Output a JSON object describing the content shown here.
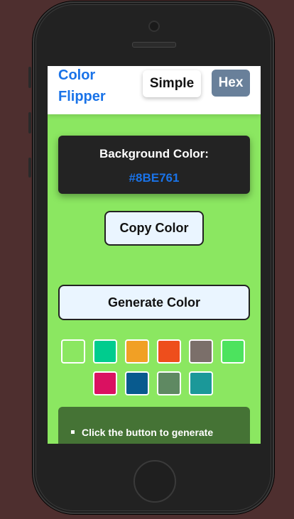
{
  "app": {
    "brand": "Color Flipper",
    "nav": {
      "simple": "Simple",
      "hex": "Hex"
    }
  },
  "display": {
    "label": "Background Color:",
    "value": "#8BE761",
    "background": "#8be761"
  },
  "buttons": {
    "copy": "Copy Color",
    "generate": "Generate Color"
  },
  "swatches": [
    "#8be761",
    "#00cc8e",
    "#f1a025",
    "#ee4e1c",
    "#7b6f6a",
    "#4ce35e",
    "#da1161",
    "#085a8e",
    "#5f8962",
    "#1b9899"
  ],
  "info": {
    "items": [
      "Click the button to generate random colors"
    ]
  }
}
